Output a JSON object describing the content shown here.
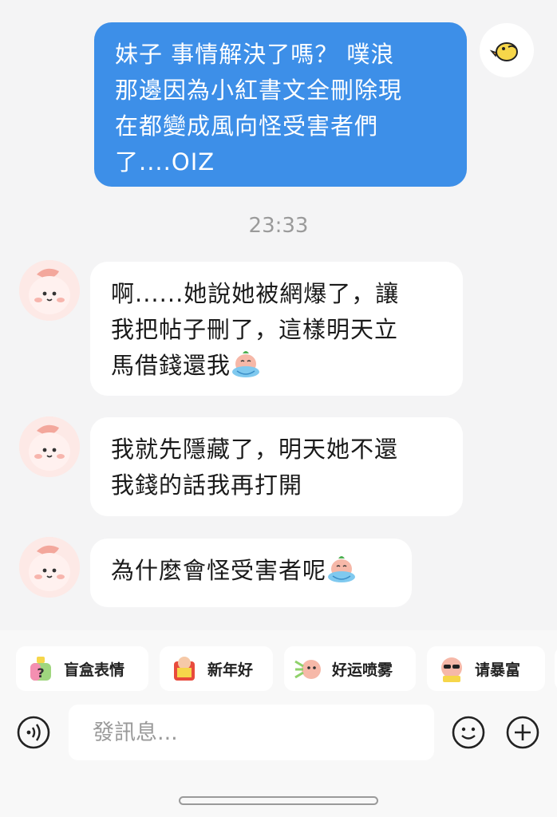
{
  "messages": [
    {
      "id": "m1",
      "direction": "out",
      "text": "妹子 事情解決了嗎？ 噗浪\n那邊因為小紅書文全刪除現\n在都變成風向怪受害者們\n了....OIZ"
    },
    {
      "id": "m2",
      "direction": "in",
      "text": "啊......她說她被網爆了，讓\n我把帖子刪了，這樣明天立\n馬借錢還我",
      "emoji": "crying-emoji"
    },
    {
      "id": "m3",
      "direction": "in",
      "text": "我就先隱藏了，明天她不還\n我錢的話我再打開"
    },
    {
      "id": "m4",
      "direction": "in",
      "text": "為什麼會怪受害者呢",
      "emoji": "crying-emoji"
    }
  ],
  "timestamp": "23:33",
  "sticker_chips": [
    {
      "label": "盲盒表情",
      "icon": "mystery-box-icon"
    },
    {
      "label": "新年好",
      "icon": "new-year-icon"
    },
    {
      "label": "好运喷雾",
      "icon": "luck-spray-icon"
    },
    {
      "label": "请暴富",
      "icon": "rich-icon"
    }
  ],
  "input": {
    "placeholder": "發訊息..."
  },
  "colors": {
    "accent": "#3d8fe8",
    "background": "#f4f4f5",
    "bubble_in": "#ffffff"
  }
}
